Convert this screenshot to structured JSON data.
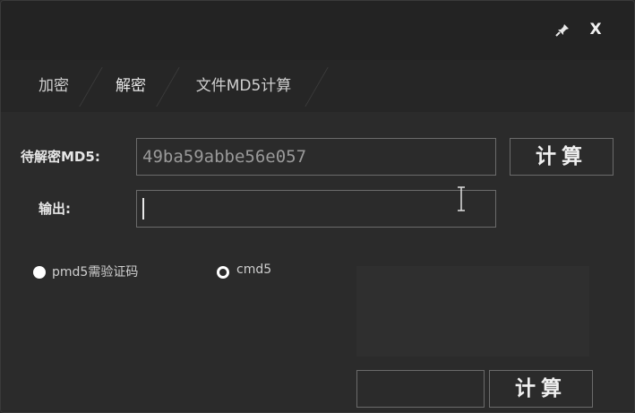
{
  "window": {
    "close_label": "X"
  },
  "tabs": [
    {
      "label": "加密"
    },
    {
      "label": "解密"
    },
    {
      "label": "文件MD5计算"
    }
  ],
  "decrypt": {
    "md5_label": "待解密MD5:",
    "md5_value": "49ba59abbe56e057",
    "output_label": "输出:",
    "output_value": "",
    "compute_label": "计算"
  },
  "modes": {
    "pmd5_label": "pmd5需验证码",
    "cmd5_label": "cmd5",
    "selected": "cmd5"
  },
  "captcha": {
    "input_value": "",
    "compute_label": "计算"
  },
  "colors": {
    "background": "#2b2b2b",
    "titlebar": "#232323",
    "tabbar": "#262626",
    "border": "#6b6b6b",
    "text": "#e6e6e6",
    "input_text": "#9a9a9a"
  },
  "icons": {
    "pin": "pin-icon",
    "close": "close-icon",
    "cursor": "text-cursor-icon"
  }
}
